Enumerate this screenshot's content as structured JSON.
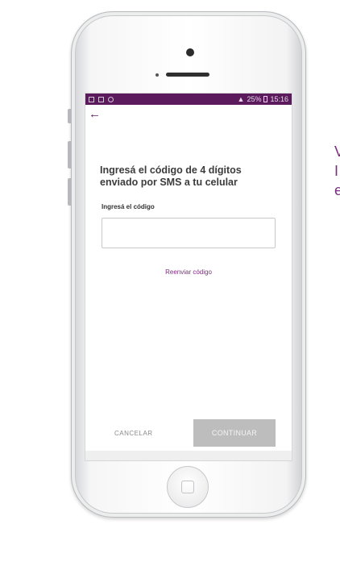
{
  "status_bar": {
    "right_text": "25%",
    "time": "15:16"
  },
  "screen": {
    "back_icon": "←",
    "heading": "Ingresá el código de 4 dígitos enviado por SMS a tu celular",
    "code_label": "Ingresá el código",
    "code_value": "",
    "code_placeholder": "",
    "resend_label": "Reenviar código",
    "cancel_label": "CANCELAR",
    "continue_label": "CONTINUAR"
  },
  "side_text": {
    "lines": [
      "V",
      "I",
      "e"
    ]
  },
  "colors": {
    "accent": "#5a1a5c",
    "link": "#7b2d7e",
    "continue_disabled": "#bdbdbd"
  },
  "icons": [
    "back-arrow-icon",
    "sms-icon",
    "image-icon",
    "signal-icon",
    "battery-icon",
    "home-button-icon"
  ]
}
